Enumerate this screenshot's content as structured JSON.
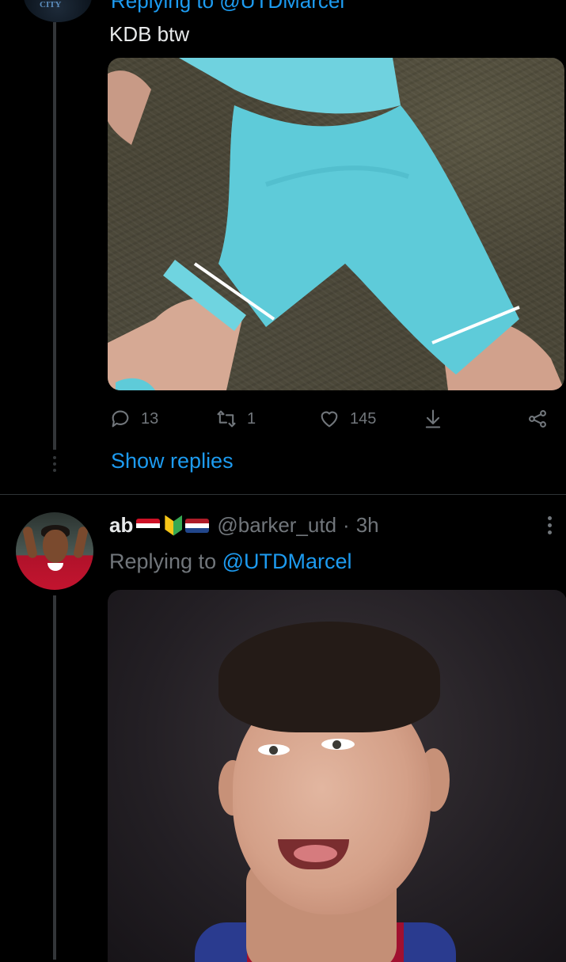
{
  "tweet1": {
    "replying_partial": "Replying to @UTDMarcel",
    "text": "KDB btw",
    "media_alt": "Player in sky-blue shorts on pitch",
    "actions": {
      "reply_count": "13",
      "retweet_count": "1",
      "like_count": "145"
    },
    "show_replies": "Show replies"
  },
  "tweet2": {
    "display_name": "ab",
    "flags": [
      "egypt-flag",
      "beginner-badge",
      "netherlands-flag"
    ],
    "handle": "@barker_utd",
    "separator": "·",
    "time": "3h",
    "replying_prefix": "Replying to",
    "replying_mention": "@UTDMarcel",
    "media_alt": "Player sticking tongue out"
  },
  "colors": {
    "background": "#000000",
    "text": "#e7e9ea",
    "muted": "#71767b",
    "accent": "#1d9bf0",
    "divider": "#2f3336"
  }
}
